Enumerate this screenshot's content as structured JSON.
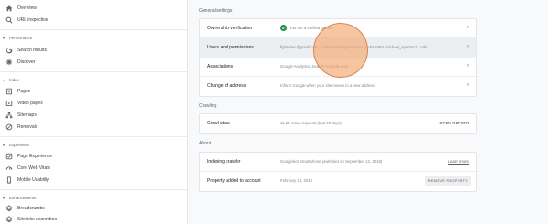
{
  "sidebar": {
    "top_items": [
      {
        "label": "Overview",
        "icon": "home-icon"
      },
      {
        "label": "URL inspection",
        "icon": "search-icon"
      }
    ],
    "sections": [
      {
        "title": "Performance",
        "items": [
          {
            "label": "Search results",
            "icon": "google-g-icon"
          },
          {
            "label": "Discover",
            "icon": "asterisk-icon"
          }
        ]
      },
      {
        "title": "Index",
        "items": [
          {
            "label": "Pages",
            "icon": "pages-icon"
          },
          {
            "label": "Video pages",
            "icon": "video-pages-icon"
          },
          {
            "label": "Sitemaps",
            "icon": "sitemaps-icon"
          },
          {
            "label": "Removals",
            "icon": "removals-icon"
          }
        ]
      },
      {
        "title": "Experience",
        "items": [
          {
            "label": "Page Experience",
            "icon": "page-experience-icon"
          },
          {
            "label": "Core Web Vitals",
            "icon": "gauge-icon"
          },
          {
            "label": "Mobile Usability",
            "icon": "phone-icon"
          }
        ]
      },
      {
        "title": "Enhancements",
        "items": [
          {
            "label": "Breadcrumbs",
            "icon": "diamond-layers-icon"
          },
          {
            "label": "Sitelinks searchbox",
            "icon": "diamond-layers-icon"
          }
        ]
      }
    ]
  },
  "general_settings": {
    "title": "General settings",
    "rows": [
      {
        "label": "Ownership verification",
        "value": "You are a verified owner",
        "status": "verified"
      },
      {
        "label": "Users and permissions",
        "value": "fightertec@gmail.com, ft.lostmyers@gmail.com, jacksont94, michael_sportscoz, robi"
      },
      {
        "label": "Associations",
        "value": "Google Analytics, Search Console and..."
      },
      {
        "label": "Change of address",
        "value": "Inform Google when your site moves to a new address"
      }
    ]
  },
  "crawling": {
    "title": "Crawling",
    "rows": [
      {
        "label": "Crawl stats",
        "value": "11.2K crawl requests (last 90 days)",
        "action": "OPEN REPORT"
      }
    ]
  },
  "about": {
    "title": "About",
    "rows": [
      {
        "label": "Indexing crawler",
        "value": "Googlebot Smartphone (switched on September 12, 2018)",
        "link": "Learn more"
      },
      {
        "label": "Property added to account",
        "value": "February 13, 2014",
        "button": "REMOVE PROPERTY"
      }
    ]
  },
  "colors": {
    "accent_green": "#1e8e3e",
    "cursor_highlight": "#f5a66e",
    "row_highlight": "#eceff1"
  }
}
